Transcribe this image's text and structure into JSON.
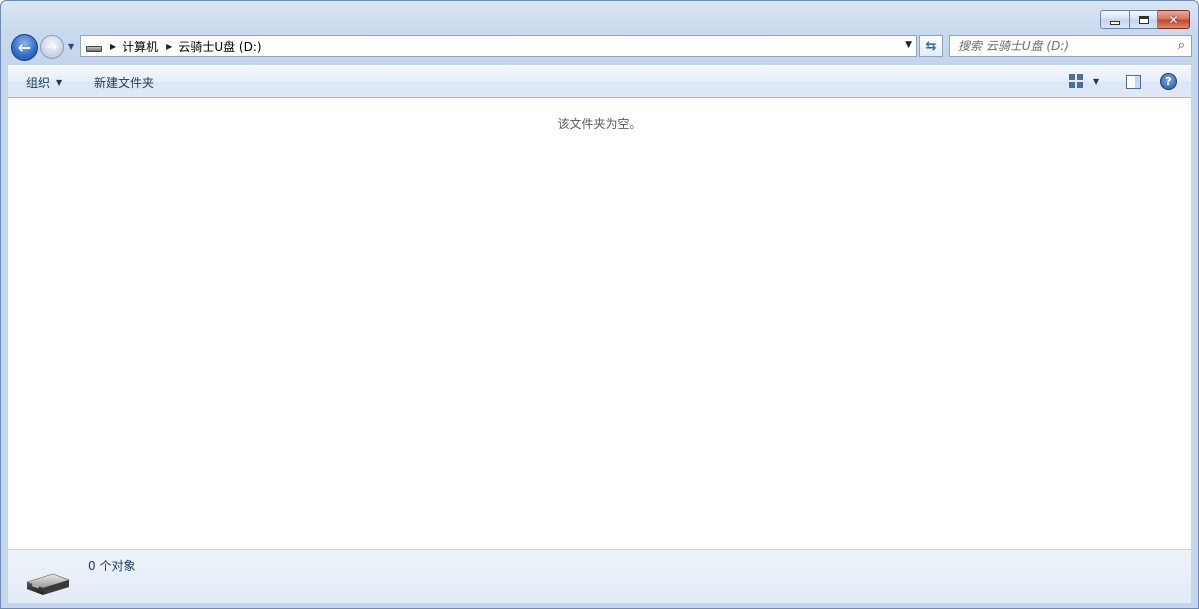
{
  "window": {
    "caption": {
      "minimize_icon": "minimize-icon",
      "maximize_icon": "maximize-icon",
      "close_glyph": "✕"
    }
  },
  "nav": {
    "back_icon": "back-arrow-icon",
    "forward_icon": "forward-arrow-icon",
    "breadcrumb": [
      "计算机",
      "云骑士U盘 (D:)"
    ],
    "refresh_icon": "refresh-icon"
  },
  "search": {
    "placeholder": "搜索 云骑士U盘 (D:)",
    "value": ""
  },
  "toolbar": {
    "organize_label": "组织",
    "new_folder_label": "新建文件夹",
    "views_icon": "views-icon",
    "preview_pane_icon": "preview-pane-icon",
    "help_glyph": "?"
  },
  "content": {
    "empty_message": "该文件夹为空。"
  },
  "details": {
    "item_count": "0 个对象",
    "drive_icon": "usb-drive-icon"
  },
  "colors": {
    "accent": "#2f6bc7",
    "close_red": "#c3452f",
    "frame": "#c4d5ec"
  }
}
